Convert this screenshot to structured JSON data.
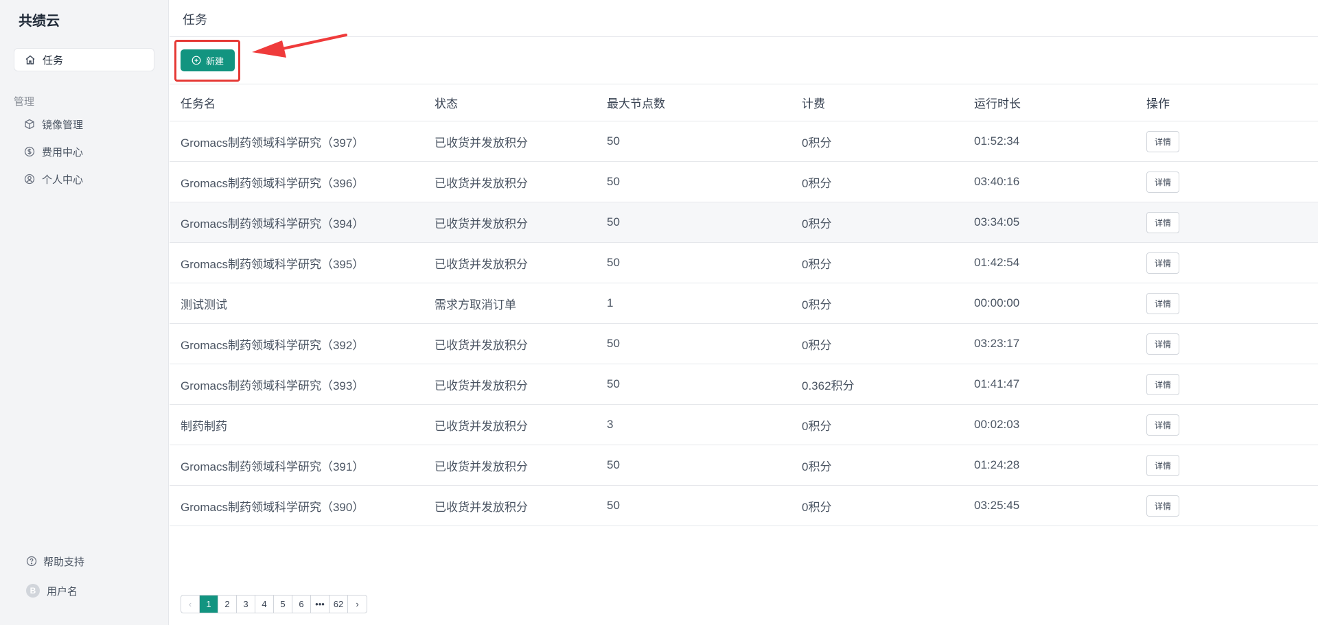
{
  "sidebar": {
    "brand": "共绩云",
    "active_item": {
      "label": "任务",
      "icon": "home-icon"
    },
    "section_label": "管理",
    "items": [
      {
        "label": "镜像管理",
        "icon": "box-icon"
      },
      {
        "label": "费用中心",
        "icon": "dollar-circle-icon"
      },
      {
        "label": "个人中心",
        "icon": "user-circle-icon"
      }
    ],
    "help_label": "帮助支持",
    "user_initial": "B",
    "user_name": "用户名"
  },
  "main": {
    "title": "任务",
    "new_button_label": "新建",
    "annotation_color": "#e53935",
    "accent_color": "#129480"
  },
  "table": {
    "headers": [
      "任务名",
      "状态",
      "最大节点数",
      "计费",
      "运行时长",
      "操作"
    ],
    "rows": [
      {
        "name": "Gromacs制药领域科学研究（397）",
        "status": "已收货并发放积分",
        "nodes": "50",
        "fee": "0积分",
        "time": "01:52:34",
        "action": "详情"
      },
      {
        "name": "Gromacs制药领域科学研究（396）",
        "status": "已收货并发放积分",
        "nodes": "50",
        "fee": "0积分",
        "time": "03:40:16",
        "action": "详情"
      },
      {
        "name": "Gromacs制药领域科学研究（394）",
        "status": "已收货并发放积分",
        "nodes": "50",
        "fee": "0积分",
        "time": "03:34:05",
        "action": "详情"
      },
      {
        "name": "Gromacs制药领域科学研究（395）",
        "status": "已收货并发放积分",
        "nodes": "50",
        "fee": "0积分",
        "time": "01:42:54",
        "action": "详情"
      },
      {
        "name": "测试测试",
        "status": "需求方取消订单",
        "nodes": "1",
        "fee": "0积分",
        "time": "00:00:00",
        "action": "详情"
      },
      {
        "name": "Gromacs制药领域科学研究（392）",
        "status": "已收货并发放积分",
        "nodes": "50",
        "fee": "0积分",
        "time": "03:23:17",
        "action": "详情"
      },
      {
        "name": "Gromacs制药领域科学研究（393）",
        "status": "已收货并发放积分",
        "nodes": "50",
        "fee": "0.362积分",
        "time": "01:41:47",
        "action": "详情"
      },
      {
        "name": "制药制药",
        "status": "已收货并发放积分",
        "nodes": "3",
        "fee": "0积分",
        "time": "00:02:03",
        "action": "详情"
      },
      {
        "name": "Gromacs制药领域科学研究（391）",
        "status": "已收货并发放积分",
        "nodes": "50",
        "fee": "0积分",
        "time": "01:24:28",
        "action": "详情"
      },
      {
        "name": "Gromacs制药领域科学研究（390）",
        "status": "已收货并发放积分",
        "nodes": "50",
        "fee": "0积分",
        "time": "03:25:45",
        "action": "详情"
      }
    ]
  },
  "pagination": {
    "prev": "‹",
    "pages": [
      "1",
      "2",
      "3",
      "4",
      "5",
      "6",
      "•••",
      "62"
    ],
    "current": "1",
    "next": "›"
  }
}
